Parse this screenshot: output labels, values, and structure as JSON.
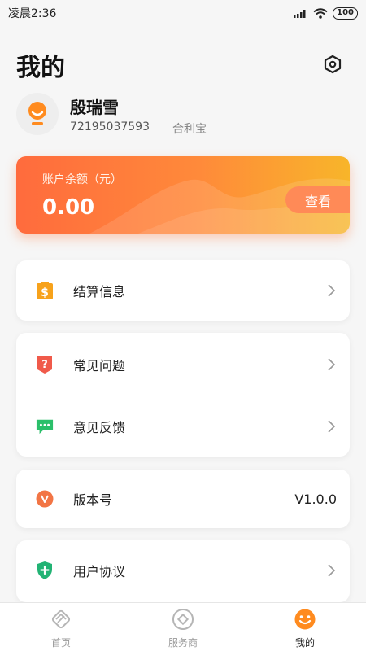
{
  "status_bar": {
    "time": "凌晨2:36",
    "battery": "100"
  },
  "header": {
    "title": "我的"
  },
  "profile": {
    "name": "殷瑞雪",
    "id": "72195037593",
    "org": "合利宝"
  },
  "balance": {
    "label": "账户余额（元）",
    "amount": "0.00",
    "view_label": "查看"
  },
  "menu": {
    "settlement": "结算信息",
    "faq": "常见问题",
    "feedback": "意见反馈",
    "version_label": "版本号",
    "version_value": "V1.0.0",
    "agreement": "用户协议"
  },
  "tabs": [
    {
      "label": "首页",
      "icon": "home-icon"
    },
    {
      "label": "服务商",
      "icon": "service-provider-icon"
    },
    {
      "label": "我的",
      "icon": "smile-icon"
    }
  ],
  "colors": {
    "accent": "#ff6b3d",
    "accent_end": "#f8b52a",
    "faq_red": "#f05a4a",
    "feedback_green": "#2bbf6a",
    "agreement_green": "#22b374",
    "active_tab": "#ff8b1f"
  }
}
